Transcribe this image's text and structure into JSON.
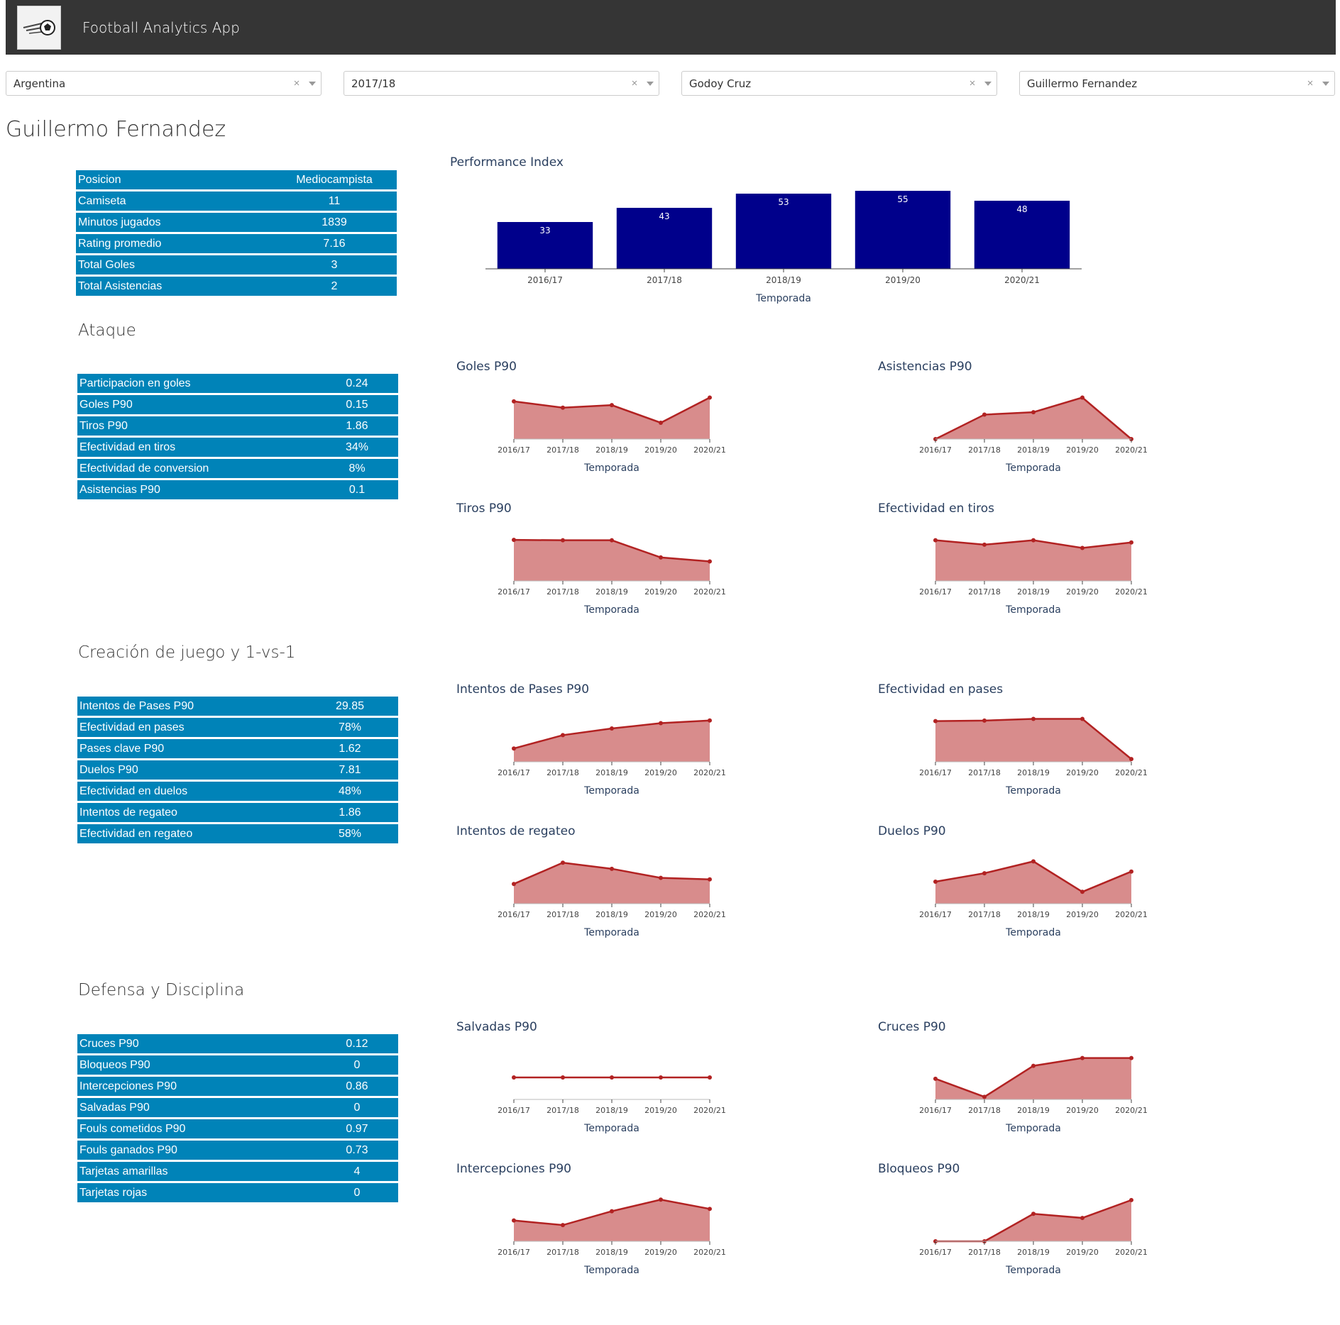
{
  "app": {
    "title": "Football Analytics App"
  },
  "filters": [
    {
      "value": "Argentina"
    },
    {
      "value": "2017/18"
    },
    {
      "value": "Godoy Cruz"
    },
    {
      "value": "Guillermo Fernandez"
    }
  ],
  "player": {
    "name": "Guillermo Fernandez"
  },
  "profile": [
    {
      "label": "Posicion",
      "value": "Mediocampista"
    },
    {
      "label": "Camiseta",
      "value": "11"
    },
    {
      "label": "Minutos jugados",
      "value": "1839"
    },
    {
      "label": "Rating promedio",
      "value": "7.16"
    },
    {
      "label": "Total Goles",
      "value": "3"
    },
    {
      "label": "Total Asistencias",
      "value": "2"
    }
  ],
  "sections": {
    "attack": {
      "title": "Ataque",
      "rows": [
        {
          "label": "Participacion en goles",
          "value": "0.24"
        },
        {
          "label": "Goles P90",
          "value": "0.15"
        },
        {
          "label": "Tiros P90",
          "value": "1.86"
        },
        {
          "label": "Efectividad en tiros",
          "value": "34%"
        },
        {
          "label": "Efectividad de conversion",
          "value": "8%"
        },
        {
          "label": "Asistencias P90",
          "value": "0.1"
        }
      ]
    },
    "creation": {
      "title": "Creación de juego y 1-vs-1",
      "rows": [
        {
          "label": "Intentos de Pases P90",
          "value": "29.85"
        },
        {
          "label": "Efectividad en pases",
          "value": "78%"
        },
        {
          "label": "Pases clave P90",
          "value": "1.62"
        },
        {
          "label": "Duelos P90",
          "value": "7.81"
        },
        {
          "label": "Efectividad en duelos",
          "value": "48%"
        },
        {
          "label": "Intentos de regateo",
          "value": "1.86"
        },
        {
          "label": "Efectividad en regateo",
          "value": "58%"
        }
      ]
    },
    "defense": {
      "title": "Defensa y Disciplina",
      "rows": [
        {
          "label": "Cruces P90",
          "value": "0.12"
        },
        {
          "label": "Bloqueos P90",
          "value": "0"
        },
        {
          "label": "Intercepciones P90",
          "value": "0.86"
        },
        {
          "label": "Salvadas P90",
          "value": "0"
        },
        {
          "label": "Fouls cometidos P90",
          "value": "0.97"
        },
        {
          "label": "Fouls ganados P90",
          "value": "0.73"
        },
        {
          "label": "Tarjetas amarillas",
          "value": "4"
        },
        {
          "label": "Tarjetas rojas",
          "value": "0"
        }
      ]
    }
  },
  "colors": {
    "bar": "#00008b",
    "line": "#b22222",
    "fill": "#d88c8c",
    "table": "#0083b8",
    "topbar": "#353535"
  },
  "chart_data": [
    {
      "id": "performance",
      "type": "bar",
      "title": "Performance Index",
      "xlabel": "Temporada",
      "categories": [
        "2016/17",
        "2017/18",
        "2018/19",
        "2019/20",
        "2020/21"
      ],
      "values": [
        33,
        43,
        53,
        55,
        48
      ],
      "ylim": [
        0,
        60
      ]
    },
    {
      "id": "goles",
      "type": "area",
      "title": "Goles P90",
      "xlabel": "Temporada",
      "categories": [
        "2016/17",
        "2017/18",
        "2018/19",
        "2019/20",
        "2020/21"
      ],
      "values": [
        0.3,
        0.25,
        0.27,
        0.13,
        0.33
      ],
      "ylim": [
        0,
        0.35
      ]
    },
    {
      "id": "asistencias",
      "type": "area",
      "title": "Asistencias P90",
      "xlabel": "Temporada",
      "categories": [
        "2016/17",
        "2017/18",
        "2018/19",
        "2019/20",
        "2020/21"
      ],
      "values": [
        0.0,
        0.1,
        0.11,
        0.17,
        0.0
      ],
      "ylim": [
        0,
        0.18
      ]
    },
    {
      "id": "tiros",
      "type": "area",
      "title": "Tiros P90",
      "xlabel": "Temporada",
      "categories": [
        "2016/17",
        "2017/18",
        "2018/19",
        "2019/20",
        "2020/21"
      ],
      "values": [
        2.1,
        2.08,
        2.08,
        1.2,
        1.0
      ],
      "ylim": [
        0,
        2.25
      ]
    },
    {
      "id": "efectividad_tiros",
      "type": "area",
      "title": "Efectividad en tiros",
      "xlabel": "Temporada",
      "categories": [
        "2016/17",
        "2017/18",
        "2018/19",
        "2019/20",
        "2020/21"
      ],
      "values": [
        37,
        33,
        37,
        30,
        35
      ],
      "ylim": [
        0,
        40
      ]
    },
    {
      "id": "intentos_pases",
      "type": "area",
      "title": "Intentos de Pases P90",
      "xlabel": "Temporada",
      "categories": [
        "2016/17",
        "2017/18",
        "2018/19",
        "2019/20",
        "2020/21"
      ],
      "values": [
        10,
        20,
        25,
        29,
        31
      ],
      "ylim": [
        0,
        33
      ]
    },
    {
      "id": "efectividad_pases",
      "type": "area",
      "title": "Efectividad en pases",
      "xlabel": "Temporada",
      "categories": [
        "2016/17",
        "2017/18",
        "2018/19",
        "2019/20",
        "2020/21"
      ],
      "values": [
        74,
        75,
        78,
        78,
        5
      ],
      "ylim": [
        0,
        80
      ]
    },
    {
      "id": "intentos_regateo",
      "type": "area",
      "title": "Intentos de regateo",
      "xlabel": "Temporada",
      "categories": [
        "2016/17",
        "2017/18",
        "2018/19",
        "2019/20",
        "2020/21"
      ],
      "values": [
        1.3,
        2.7,
        2.3,
        1.7,
        1.6
      ],
      "ylim": [
        0,
        2.9
      ]
    },
    {
      "id": "duelos",
      "type": "area",
      "title": "Duelos P90",
      "xlabel": "Temporada",
      "categories": [
        "2016/17",
        "2017/18",
        "2018/19",
        "2019/20",
        "2020/21"
      ],
      "values": [
        6.5,
        9.0,
        12.5,
        3.5,
        9.5
      ],
      "ylim": [
        0,
        13
      ]
    },
    {
      "id": "salvadas",
      "type": "area",
      "title": "Salvadas P90",
      "xlabel": "Temporada",
      "categories": [
        "2016/17",
        "2017/18",
        "2018/19",
        "2019/20",
        "2020/21"
      ],
      "values": [
        0,
        0,
        0,
        0,
        0
      ],
      "ylim": [
        -1,
        1
      ]
    },
    {
      "id": "cruces",
      "type": "area",
      "title": "Cruces P90",
      "xlabel": "Temporada",
      "categories": [
        "2016/17",
        "2017/18",
        "2018/19",
        "2019/20",
        "2020/21"
      ],
      "values": [
        0.16,
        0.02,
        0.26,
        0.32,
        0.32
      ],
      "ylim": [
        0,
        0.34
      ]
    },
    {
      "id": "intercepciones",
      "type": "area",
      "title": "Intercepciones P90",
      "xlabel": "Temporada",
      "categories": [
        "2016/17",
        "2017/18",
        "2018/19",
        "2019/20",
        "2020/21"
      ],
      "values": [
        0.9,
        0.7,
        1.3,
        1.8,
        1.4
      ],
      "ylim": [
        0,
        1.9
      ]
    },
    {
      "id": "bloqueos",
      "type": "area",
      "title": "Bloqueos P90",
      "xlabel": "Temporada",
      "categories": [
        "2016/17",
        "2017/18",
        "2018/19",
        "2019/20",
        "2020/21"
      ],
      "values": [
        0,
        0,
        0.2,
        0.17,
        0.3
      ],
      "ylim": [
        0,
        0.32
      ]
    }
  ]
}
